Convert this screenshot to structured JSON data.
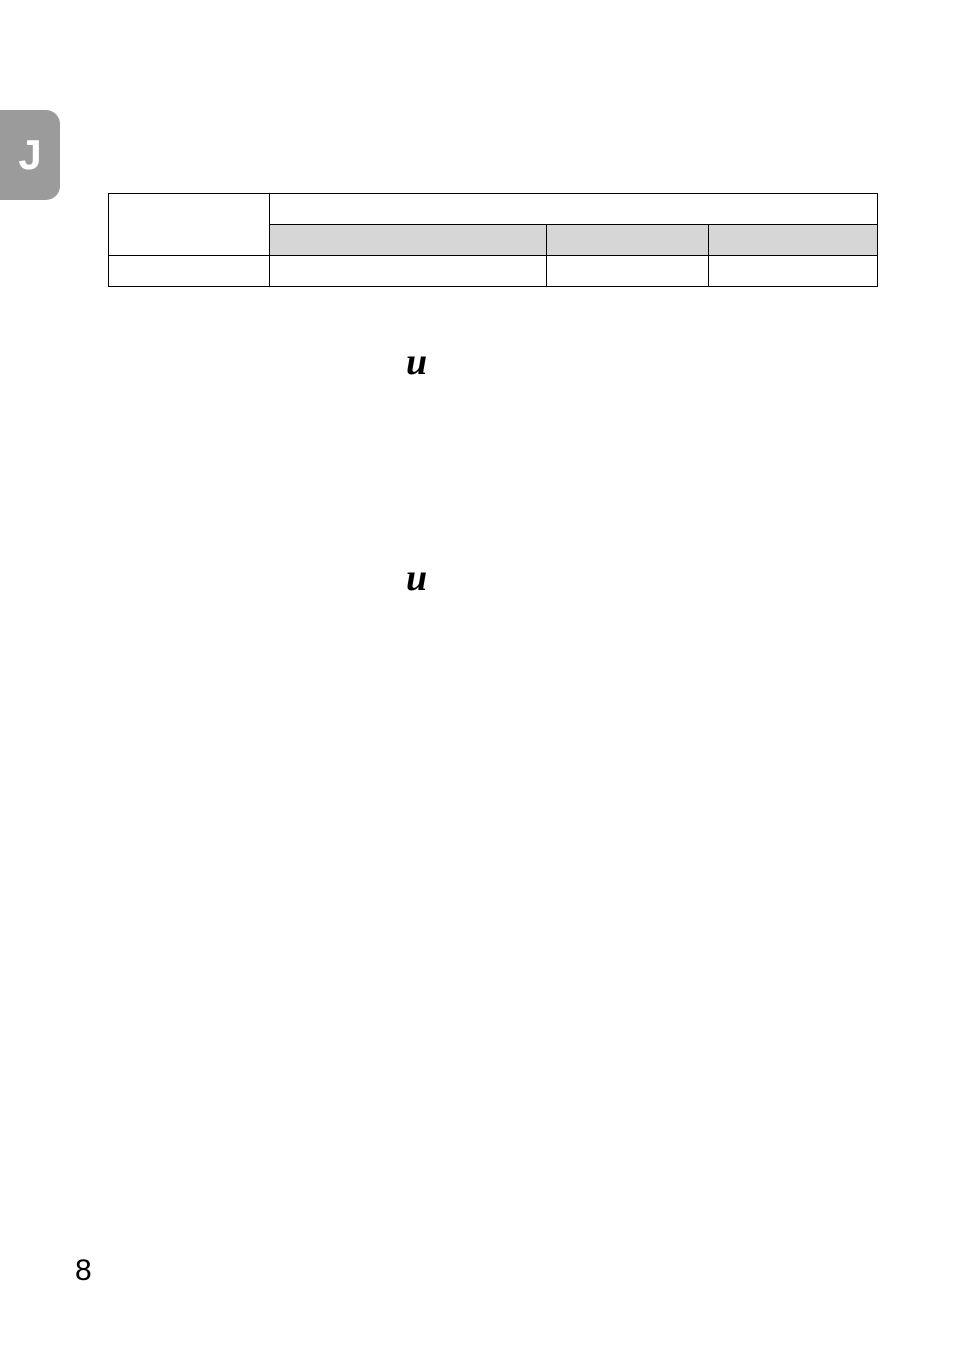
{
  "tab_letter": "J",
  "glyph1": "u",
  "glyph2": "u",
  "page_number": "8"
}
